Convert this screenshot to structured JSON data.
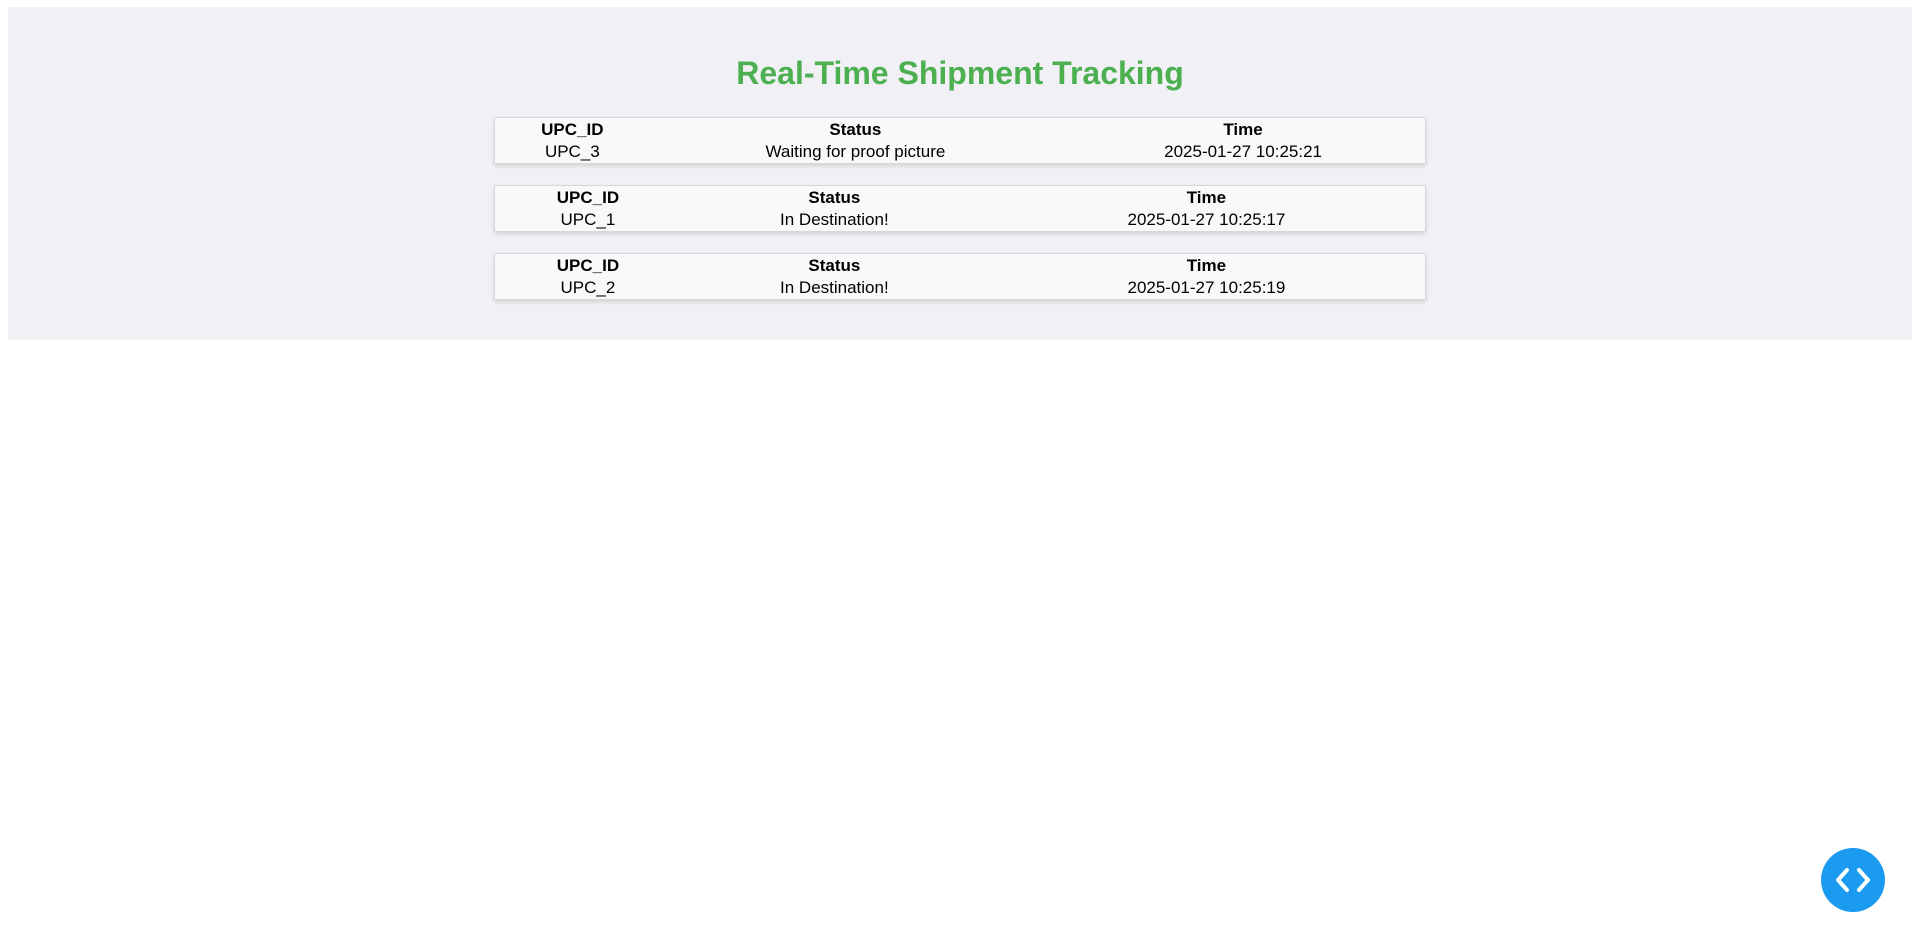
{
  "header": {
    "title": "Real-Time Shipment Tracking"
  },
  "shipments": [
    {
      "headers": {
        "upc": "UPC_ID",
        "status": "Status",
        "time": "Time"
      },
      "upc": "UPC_3",
      "status": "Waiting for proof picture",
      "time": "2025-01-27 10:25:21"
    },
    {
      "headers": {
        "upc": "UPC_ID",
        "status": "Status",
        "time": "Time"
      },
      "upc": "UPC_1",
      "status": "In Destination!",
      "time": "2025-01-27 10:25:17"
    },
    {
      "headers": {
        "upc": "UPC_ID",
        "status": "Status",
        "time": "Time"
      },
      "upc": "UPC_2",
      "status": "In Destination!",
      "time": "2025-01-27 10:25:19"
    }
  ],
  "floating_button": {
    "icon": "code-icon",
    "color": "#1a9bf0"
  },
  "colors": {
    "title": "#4caf50",
    "panel_bg": "#f0f0f5",
    "table_bg": "#f9f9f9"
  }
}
